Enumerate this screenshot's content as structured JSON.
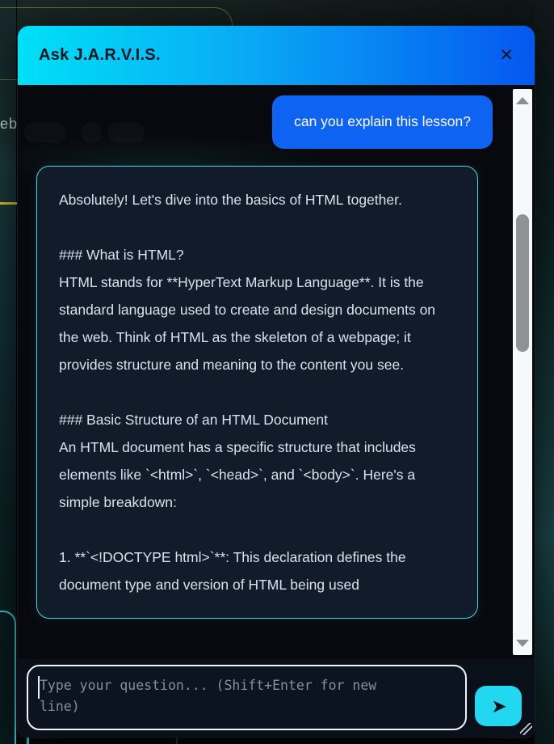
{
  "window": {
    "title": "Ask J.A.R.V.I.S.",
    "close_icon": "✕"
  },
  "chat": {
    "messages": [
      {
        "role": "user",
        "text": "can you explain this lesson?"
      },
      {
        "role": "assistant",
        "text": "Absolutely! Let's dive into the basics of HTML together.\n\n### What is HTML?\nHTML stands for **HyperText Markup Language**. It is the standard language used to create and design documents on the web. Think of HTML as the skeleton of a webpage; it provides structure and meaning to the content you see.\n\n### Basic Structure of an HTML Document\nAn HTML document has a specific structure that includes elements like `<html>`, `<head>`, and `<body>`. Here's a simple breakdown:\n\n1. **`<!DOCTYPE html>`**: This declaration defines the document type and version of HTML being used"
      }
    ]
  },
  "composer": {
    "placeholder": "Type your question... (Shift+Enter for new line)",
    "send_icon": "➤"
  },
  "background_page": {
    "partial_text": "eb"
  },
  "colors": {
    "header_gradient_start": "#00e0f7",
    "header_gradient_end": "#0557f0",
    "user_bubble": "#0e63f2",
    "assistant_bubble_bg": "#111b29",
    "assistant_border": "#45d6e8",
    "send_button": "#22d7f0",
    "accent_yellow": "#e6da24",
    "accent_cyan": "#35dfe8"
  }
}
